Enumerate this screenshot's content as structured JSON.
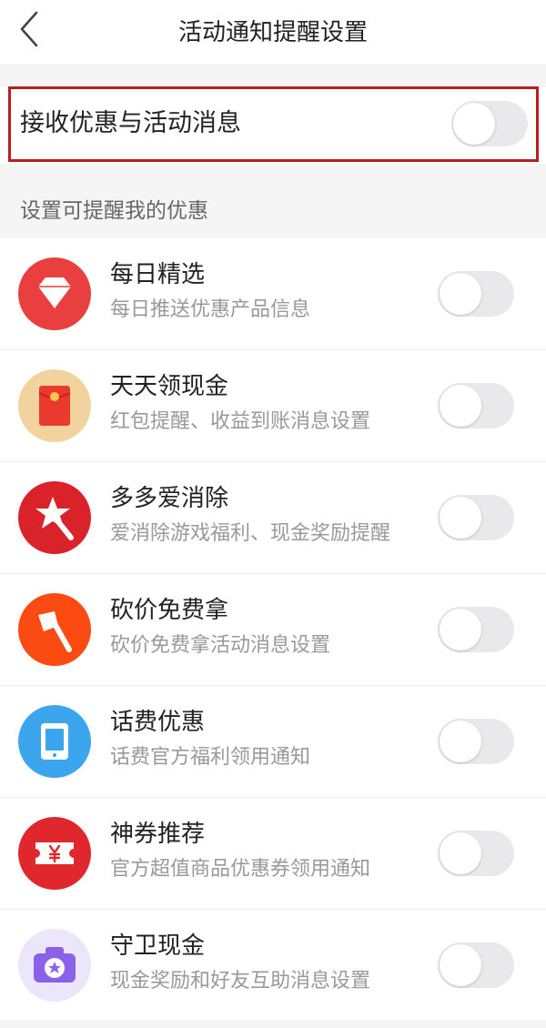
{
  "header": {
    "title": "活动通知提醒设置",
    "back_icon": "chevron-left-icon"
  },
  "master": {
    "label": "接收优惠与活动消息",
    "enabled": false
  },
  "section": {
    "label": "设置可提醒我的优惠"
  },
  "items": [
    {
      "title": "每日精选",
      "desc": "每日推送优惠产品信息",
      "icon": "diamond-icon",
      "color": "#e93f3f",
      "enabled": false
    },
    {
      "title": "天天领现金",
      "desc": "红包提醒、收益到账消息设置",
      "icon": "red-envelope-icon",
      "color": "#f2d39e",
      "enabled": false
    },
    {
      "title": "多多爱消除",
      "desc": "爱消除游戏福利、现金奖励提醒",
      "icon": "magic-wand-icon",
      "color": "#d9222a",
      "enabled": false
    },
    {
      "title": "砍价免费拿",
      "desc": "砍价免费拿活动消息设置",
      "icon": "axe-icon",
      "color": "#fb4b12",
      "enabled": false
    },
    {
      "title": "话费优惠",
      "desc": "话费官方福利领用通知",
      "icon": "mobile-phone-icon",
      "color": "#3ba6ee",
      "enabled": false
    },
    {
      "title": "神券推荐",
      "desc": "官方超值商品优惠券领用通知",
      "icon": "coupon-icon",
      "color": "#e0272e",
      "enabled": false
    },
    {
      "title": "守卫现金",
      "desc": "现金奖励和好友互助消息设置",
      "icon": "camera-star-icon",
      "color": "#ece6fb",
      "enabled": false
    }
  ],
  "colors": {
    "highlight_border": "#b81e1e",
    "switch_off": "#e9e9eb"
  }
}
